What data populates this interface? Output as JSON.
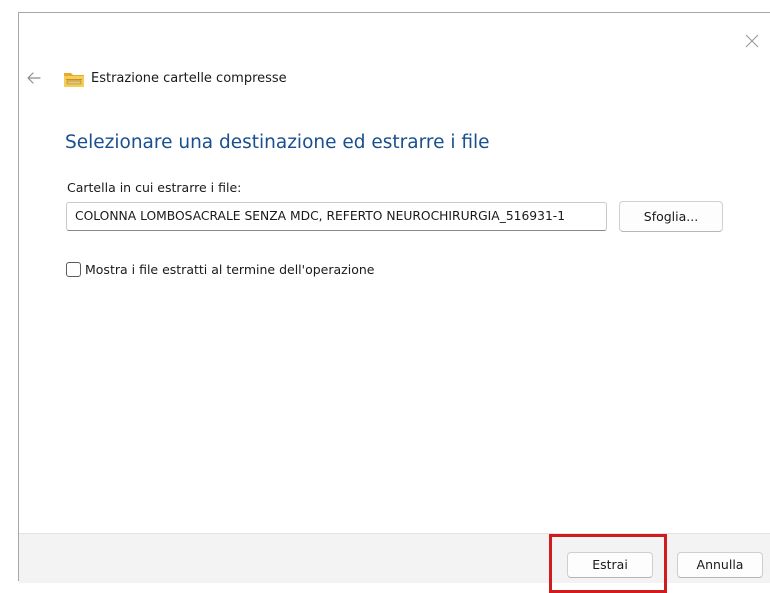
{
  "window": {
    "title": "Estrazione cartelle compresse"
  },
  "main": {
    "heading": "Selezionare una destinazione ed estrarre i file",
    "destination_label": "Cartella in cui estrarre i file:",
    "destination_value": "COLONNA LOMBOSACRALE SENZA MDC, REFERTO NEUROCHIRURGIA_516931-1",
    "browse_label": "Sfoglia...",
    "show_files_label": "Mostra i file estratti al termine dell'operazione",
    "show_files_checked": false
  },
  "footer": {
    "extract_label": "Estrai",
    "cancel_label": "Annulla"
  },
  "icons": {
    "close": "close-icon",
    "back": "back-arrow-icon",
    "folder": "zip-folder-icon"
  },
  "colors": {
    "heading": "#1a4f8f",
    "highlight": "#d01c1f",
    "footer_bg": "#f3f3f3",
    "folder": "#f2c14e"
  }
}
